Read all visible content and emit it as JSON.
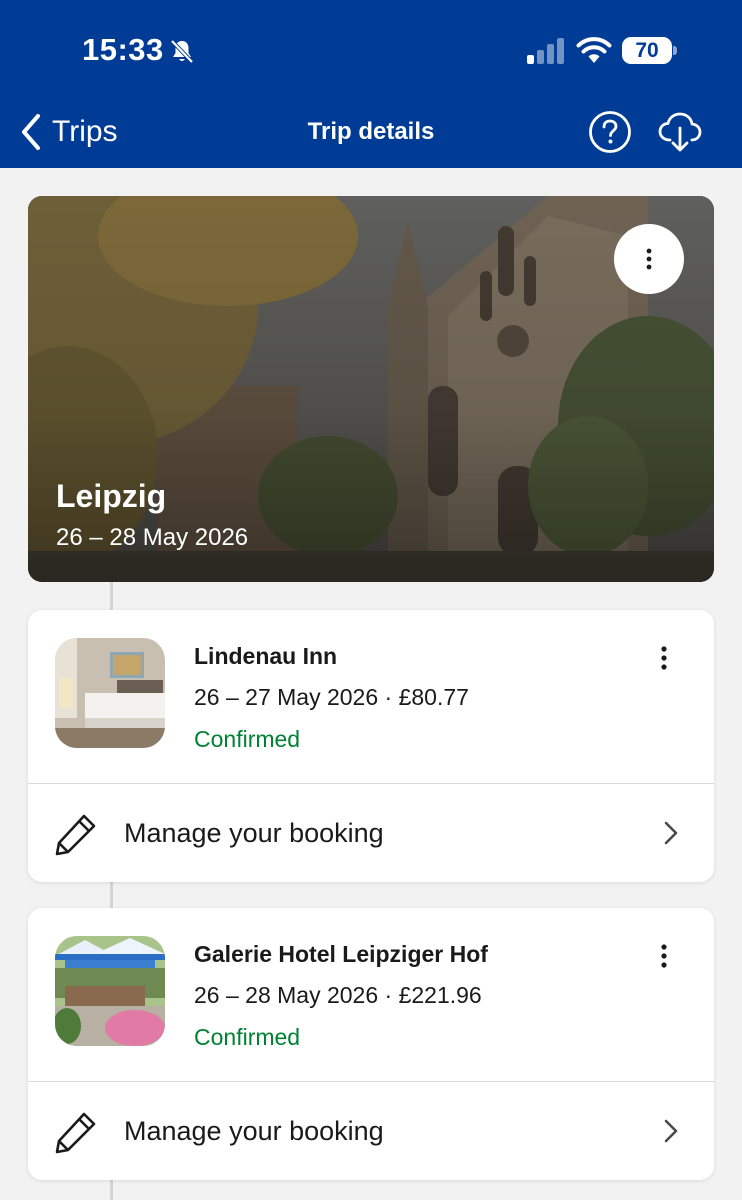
{
  "status_bar": {
    "time": "15:33",
    "battery": "70",
    "icons": [
      "bell-slash-icon",
      "cellular-signal-icon",
      "wifi-icon",
      "battery-icon"
    ]
  },
  "nav": {
    "back_label": "Trips",
    "title": "Trip details",
    "icons": [
      "chevron-left-icon",
      "help-icon",
      "cloud-download-icon"
    ]
  },
  "destination": {
    "name": "Leipzig",
    "dates": "26 – 28 May 2026"
  },
  "bookings": [
    {
      "name": "Lindenau Inn",
      "meta": "26 – 27 May 2026 · £80.77",
      "status": "Confirmed",
      "manage_label": "Manage your booking"
    },
    {
      "name": "Galerie Hotel Leipziger Hof",
      "meta": "26 – 28 May 2026 · £221.96",
      "status": "Confirmed",
      "manage_label": "Manage your booking"
    }
  ],
  "colors": {
    "brand_blue": "#003b95",
    "confirmed_green": "#008234",
    "background": "#f2f2f2"
  }
}
